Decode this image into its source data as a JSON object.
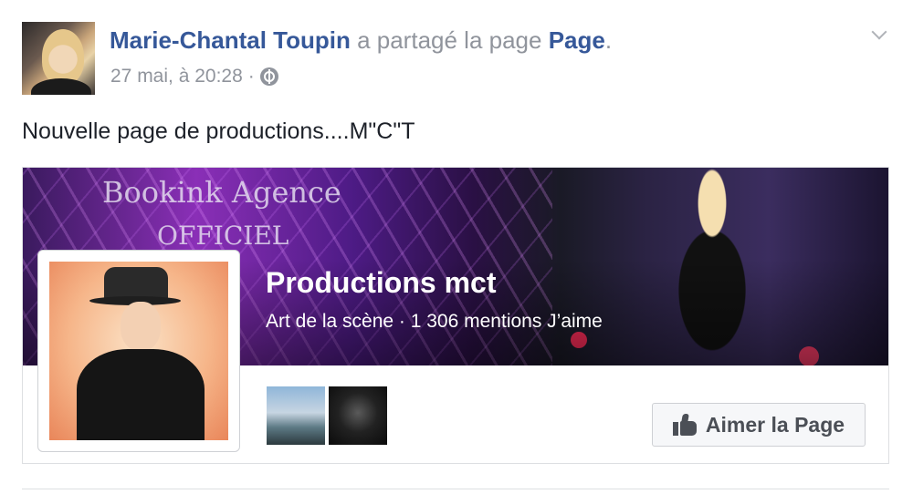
{
  "post": {
    "author": "Marie-Chantal Toupin",
    "action": " a partagé la page ",
    "shared_link": "Page",
    "period": ".",
    "timestamp": "27 mai, à 20:28",
    "separator": "·",
    "privacy_icon": "globe-icon",
    "menu_icon": "chevron-down-icon",
    "text": "Nouvelle page de productions....M\"C\"T"
  },
  "card": {
    "cover_line1": "Bookink Agence",
    "cover_line2": "OFFICIEL",
    "page_name": "Productions mct",
    "page_sub": "Art de la scène · 1 306 mentions J’aime",
    "like_button": "Aimer la Page",
    "like_icon": "thumbs-up-icon"
  },
  "colors": {
    "link": "#365899",
    "meta": "#90949c",
    "text": "#1d2129",
    "button_bg": "#f6f7f9"
  }
}
